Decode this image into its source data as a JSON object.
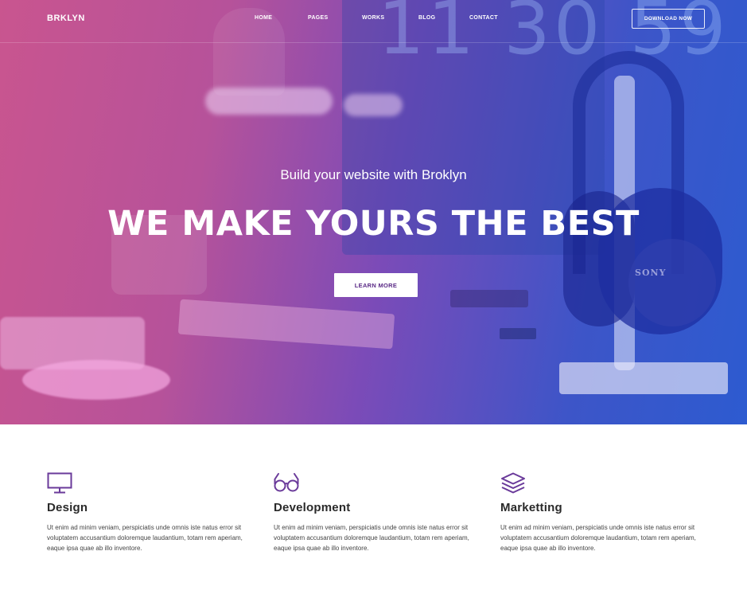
{
  "brand": {
    "logo": "BRKLYN",
    "accent": "#6a3a9a"
  },
  "nav": {
    "items": [
      "HOME",
      "PAGES",
      "WORKS",
      "BLOG",
      "CONTACT"
    ],
    "cta": "DOWNLOAD NOW"
  },
  "hero": {
    "subtitle": "Build your website with Broklyn",
    "title": "WE MAKE YOURS THE BEST",
    "button": "LEARN MORE",
    "monitor_text": "11 30 59",
    "headphone_brand": "SONY"
  },
  "features": [
    {
      "icon": "monitor-icon",
      "title": "Design",
      "text": "Ut enim ad minim veniam,  perspiciatis unde omnis iste natus error sit voluptatem accusantium doloremque laudantium, totam rem aperiam, eaque ipsa quae ab illo inventore."
    },
    {
      "icon": "glasses-icon",
      "title": "Development",
      "text": "Ut enim ad minim veniam,  perspiciatis unde omnis iste natus error sit voluptatem accusantium doloremque laudantium, totam rem aperiam, eaque ipsa quae ab illo inventore."
    },
    {
      "icon": "layers-icon",
      "title": "Marketting",
      "text": "Ut enim ad minim veniam,  perspiciatis unde omnis iste natus error sit voluptatem accusantium doloremque laudantium, totam rem aperiam, eaque ipsa quae ab illo inventore."
    }
  ]
}
